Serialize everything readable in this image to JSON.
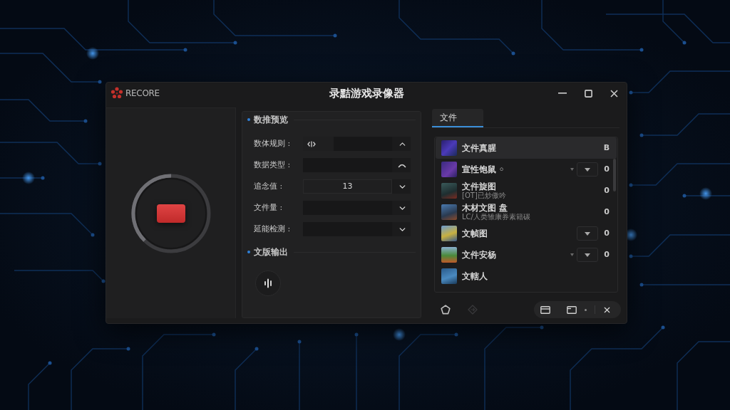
{
  "window": {
    "logo_text": "RECORE",
    "title": "录黠游戏录像器"
  },
  "recorder": {
    "recording": true
  },
  "preview": {
    "title": "数推预览",
    "fields": [
      {
        "kind": "range",
        "label": "数体规则 :"
      },
      {
        "kind": "action",
        "label": "数据类型 :"
      },
      {
        "kind": "select",
        "label": "追念值 :",
        "value": "13"
      },
      {
        "kind": "select",
        "label": "文件量 :"
      },
      {
        "kind": "select",
        "label": "延能检测 :"
      }
    ]
  },
  "output": {
    "title": "文版输出"
  },
  "files": {
    "tabs": [
      {
        "label": "文件",
        "selected": true
      }
    ],
    "items": [
      {
        "title": "文件真腥",
        "value": "B",
        "selected": true,
        "caret": false,
        "dropdown": false
      },
      {
        "title": "宣性饱鼠 ◦",
        "value": "0",
        "selected": false,
        "caret": true,
        "dropdown": true
      },
      {
        "title": "文件旋图",
        "subtitle": "[OT]已炒傲吟",
        "value": "0",
        "selected": false,
        "caret": false,
        "dropdown": false
      },
      {
        "title": "木材文图 盘",
        "subtitle": "LC/人类雏康券素籍碳",
        "value": "0",
        "selected": false,
        "caret": false,
        "dropdown": false
      },
      {
        "title": "文帧图",
        "value": "0",
        "selected": false,
        "caret": false,
        "dropdown": true
      },
      {
        "title": "文件安杨",
        "value": "0",
        "selected": false,
        "caret": true,
        "dropdown": true
      },
      {
        "title": "文轄人",
        "selected": false,
        "caret": false,
        "dropdown": false
      }
    ],
    "tools": [
      {
        "kind": "reset",
        "disabled": false
      },
      {
        "kind": "forward",
        "disabled": true
      }
    ]
  }
}
